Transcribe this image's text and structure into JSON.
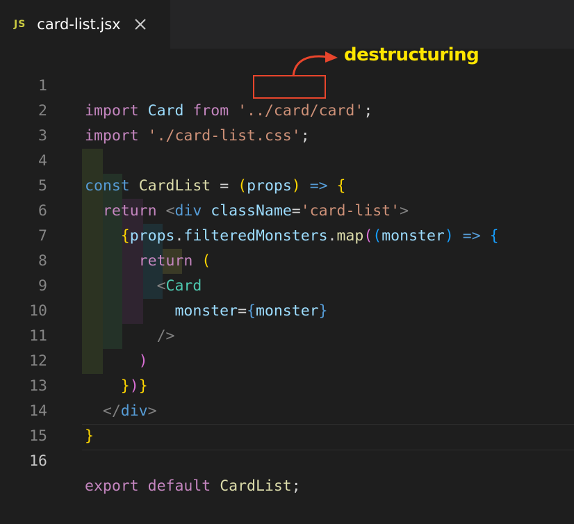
{
  "tab": {
    "icon_text": "JS",
    "title": "card-list.jsx",
    "close_icon": "close-icon"
  },
  "lines": [
    {
      "n": "1"
    },
    {
      "n": "2"
    },
    {
      "n": "3"
    },
    {
      "n": "4"
    },
    {
      "n": "5"
    },
    {
      "n": "6"
    },
    {
      "n": "7"
    },
    {
      "n": "8"
    },
    {
      "n": "9"
    },
    {
      "n": "10"
    },
    {
      "n": "11"
    },
    {
      "n": "12"
    },
    {
      "n": "13"
    },
    {
      "n": "14"
    },
    {
      "n": "15"
    },
    {
      "n": "16"
    }
  ],
  "tok": {
    "import": "import",
    "from": "from",
    "card": "Card",
    "card_path": "'../card/card'",
    "semi": ";",
    "css_path": "'./card-list.css'",
    "const": "const",
    "cardlist": "CardList",
    "eq": "=",
    "paren_open": "(",
    "props": "props",
    "paren_close": ")",
    "arrow": "=>",
    "brace_open": "{",
    "brace_close": "}",
    "return": "return",
    "lt": "<",
    "div": "div",
    "classname": "className",
    "classname_val": "'card-list'",
    "gt": ">",
    "dot": ".",
    "filtered": "filteredMonsters",
    "map": "map",
    "monster": "monster",
    "selfclose": "/>",
    "closetag": "</",
    "export": "export",
    "default": "default"
  },
  "annotation": {
    "label": "destructuring"
  },
  "colors": {
    "background": "#1e1e1e",
    "keyword": "#c586c0",
    "string": "#ce9178",
    "annotation_box": "#e8452c",
    "annotation_text": "#ffe600"
  }
}
